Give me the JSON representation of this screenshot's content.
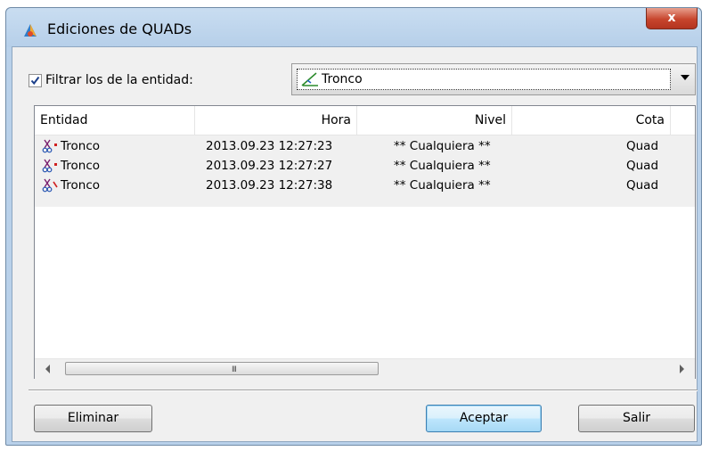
{
  "window": {
    "title": "Ediciones de QUADs",
    "close_label": "x"
  },
  "filter": {
    "checked": true,
    "label": "Filtrar los de la entidad:"
  },
  "entity_select": {
    "selected": "Tronco"
  },
  "list": {
    "columns": [
      "Entidad",
      "Hora",
      "Nivel",
      "Cota"
    ],
    "rows": [
      {
        "entidad": "Tronco",
        "hora": "2013.09.23 12:27:23",
        "nivel": "** Cualquiera **",
        "cota": "Quad"
      },
      {
        "entidad": "Tronco",
        "hora": "2013.09.23 12:27:27",
        "nivel": "** Cualquiera **",
        "cota": "Quad"
      },
      {
        "entidad": "Tronco",
        "hora": "2013.09.23 12:27:38",
        "nivel": "** Cualquiera **",
        "cota": "Quad"
      }
    ],
    "scroll_grip": "III"
  },
  "buttons": {
    "delete": "Eliminar",
    "accept": "Aceptar",
    "exit": "Salir"
  },
  "icons": {
    "app": "app-icon",
    "entity": "scissors-icon",
    "combo": "line-entity-icon"
  }
}
